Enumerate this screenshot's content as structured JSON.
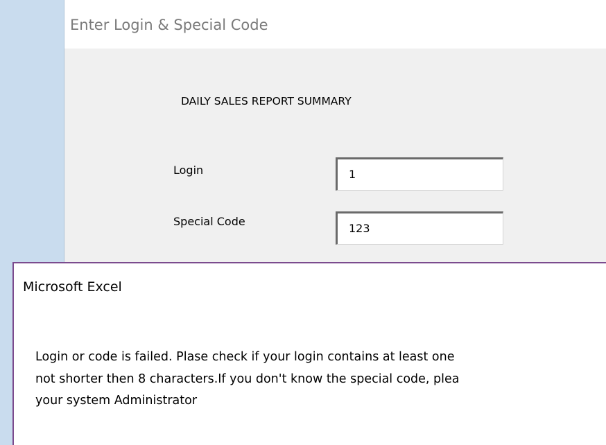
{
  "form": {
    "title": "Enter Login & Special Code",
    "heading": "DAILY SALES REPORT SUMMARY",
    "login_label": "Login",
    "login_value": "1",
    "code_label": "Special Code",
    "code_value": "123"
  },
  "message_box": {
    "title": "Microsoft Excel",
    "lines": [
      "Login or code is failed. Plase check if your login contains at least one",
      "not shorter then 8 characters.If you don't know the special code, plea",
      "your system Administrator"
    ]
  },
  "colors": {
    "left_strip": "#c9dcee",
    "form_background": "#f0f0f0",
    "dialog_border": "#7b4b8e"
  }
}
